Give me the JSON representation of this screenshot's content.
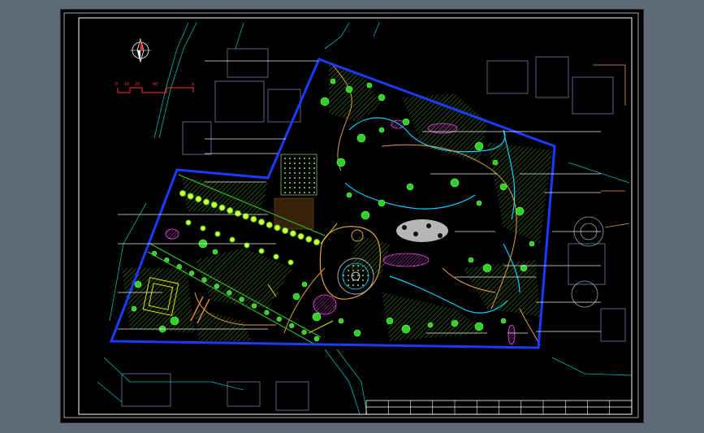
{
  "viewport": {
    "background": "#000000",
    "app_background": "#5e6a78"
  },
  "colors": {
    "site_boundary": "#1a3cff",
    "frame": "#ffffff",
    "roads": "#00c8c8",
    "paths": "#e0a040",
    "trees": "#2fd12f",
    "shrubs": "#7dff3a",
    "flowers": "#ff40ff",
    "water": "#00d0ff",
    "hatch": "#9bd32a",
    "scale_bar": "#ff3030"
  },
  "north_arrow": {
    "icon": "north-arrow-icon"
  },
  "scale_bar": {
    "ticks": [
      "0",
      "10",
      "20",
      "40"
    ],
    "unit": "m"
  },
  "title_block": {
    "columns": 12
  }
}
